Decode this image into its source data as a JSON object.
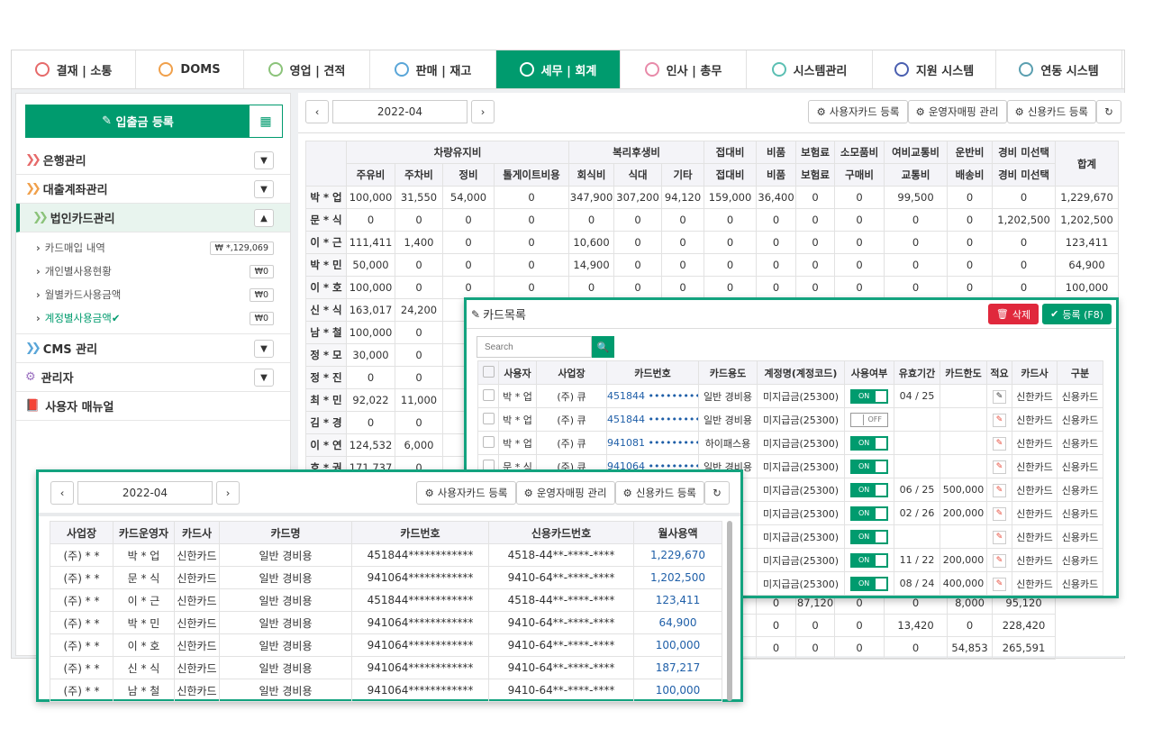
{
  "nav": {
    "tabs": [
      {
        "label": "결재 | 소통",
        "icon": "approval-icon",
        "color": "#e66a6a"
      },
      {
        "label": "DOMS",
        "icon": "doms-icon",
        "color": "#f0a04b"
      },
      {
        "label": "영업 | 견적",
        "icon": "sales-icon",
        "color": "#8bc37a"
      },
      {
        "label": "판매 | 재고",
        "icon": "cart-icon",
        "color": "#5aa6d8"
      },
      {
        "label": "세무 | 회계",
        "icon": "won-icon",
        "color": "#ffffff",
        "active": true
      },
      {
        "label": "인사 | 총무",
        "icon": "person-icon",
        "color": "#e88aa9"
      },
      {
        "label": "시스템관리",
        "icon": "monitor-icon",
        "color": "#5bbfb3"
      },
      {
        "label": "지원 시스템",
        "icon": "support-icon",
        "color": "#4a5fb0"
      },
      {
        "label": "연동 시스템",
        "icon": "link-icon",
        "color": "#5a9fb0"
      }
    ]
  },
  "sidebar": {
    "register_label": "입출금 등록",
    "menus": [
      {
        "label": "은행관리",
        "color": "#e66a6a"
      },
      {
        "label": "대출계좌관리",
        "color": "#f0a04b"
      },
      {
        "label": "법인카드관리",
        "color": "#8bc37a"
      }
    ],
    "subitems": [
      {
        "label": "카드매입 내역",
        "badge": "₩ *,129,069"
      },
      {
        "label": "개인별사용현황",
        "badge": "₩0"
      },
      {
        "label": "월별카드사용금액",
        "badge": "₩0"
      },
      {
        "label": "계정별사용금액",
        "badge": "₩0",
        "active": true
      }
    ],
    "menus2": [
      {
        "label": "CMS 관리",
        "color": "#5aa6d8",
        "icon": "double-chevron-icon"
      },
      {
        "label": "관리자",
        "color": "#9a6fbf",
        "icon": "gear-icon"
      },
      {
        "label": "사용자 매뉴얼",
        "color": "#e66a6a",
        "icon": "book-icon"
      }
    ]
  },
  "toolbar": {
    "month": "2022-04",
    "user_card": "사용자카드 등록",
    "operator_map": "운영자매핑 관리",
    "credit_card": "신용카드 등록"
  },
  "summary": {
    "groups": [
      [
        "차량유지비",
        4
      ],
      [
        "복리후생비",
        3
      ],
      [
        "접대비",
        1
      ],
      [
        "비품",
        1
      ],
      [
        "보험료",
        1
      ],
      [
        "소모품비",
        1
      ],
      [
        "여비교통비",
        1
      ],
      [
        "운반비",
        1
      ],
      [
        "경비 미선택",
        1
      ]
    ],
    "total_label": "합계",
    "subheaders": [
      "주유비",
      "주차비",
      "정비",
      "톨게이트비용",
      "회식비",
      "식대",
      "기타",
      "접대비",
      "비품",
      "보험료",
      "구매비",
      "교통비",
      "배송비",
      "경비 미선택"
    ],
    "rows": [
      [
        "박 * 업",
        "100,000",
        "31,550",
        "54,000",
        "0",
        "347,900",
        "307,200",
        "94,120",
        "159,000",
        "36,400",
        "0",
        "0",
        "99,500",
        "0",
        "0",
        "1,229,670"
      ],
      [
        "문 * 식",
        "0",
        "0",
        "0",
        "0",
        "0",
        "0",
        "0",
        "0",
        "0",
        "0",
        "0",
        "0",
        "0",
        "1,202,500",
        "1,202,500"
      ],
      [
        "이 * 근",
        "111,411",
        "1,400",
        "0",
        "0",
        "10,600",
        "0",
        "0",
        "0",
        "0",
        "0",
        "0",
        "0",
        "0",
        "0",
        "123,411"
      ],
      [
        "박 * 민",
        "50,000",
        "0",
        "0",
        "0",
        "14,900",
        "0",
        "0",
        "0",
        "0",
        "0",
        "0",
        "0",
        "0",
        "0",
        "64,900"
      ],
      [
        "이 * 호",
        "100,000",
        "0",
        "0",
        "0",
        "0",
        "0",
        "0",
        "0",
        "0",
        "0",
        "0",
        "0",
        "0",
        "0",
        "100,000"
      ],
      [
        "신 * 식",
        "163,017",
        "24,200",
        "",
        "",
        "",
        "",
        "",
        "",
        "",
        "",
        "",
        "",
        "",
        "",
        ""
      ],
      [
        "남 * 철",
        "100,000",
        "0",
        "",
        "",
        "",
        "",
        "",
        "",
        "",
        "",
        "",
        "",
        "",
        "",
        ""
      ],
      [
        "정 * 모",
        "30,000",
        "0",
        "",
        "",
        "",
        "",
        "",
        "",
        "",
        "",
        "",
        "",
        "",
        "",
        ""
      ],
      [
        "정 * 진",
        "0",
        "0",
        "",
        "",
        "",
        "",
        "",
        "",
        "",
        "",
        "",
        "",
        "",
        "",
        ""
      ],
      [
        "최 * 민",
        "92,022",
        "11,000",
        "",
        "",
        "",
        "",
        "",
        "",
        "",
        "",
        "",
        "",
        "",
        "",
        ""
      ],
      [
        "김 * 경",
        "0",
        "0",
        "",
        "",
        "",
        "",
        "",
        "",
        "",
        "",
        "",
        "",
        "",
        "",
        ""
      ],
      [
        "이 * 연",
        "124,532",
        "6,000",
        "",
        "",
        "",
        "",
        "",
        "",
        "",
        "",
        "",
        "",
        "",
        "",
        ""
      ],
      [
        "호 * 권",
        "171,737",
        "0",
        "",
        "",
        "",
        "",
        "",
        "",
        "",
        "",
        "",
        "",
        "",
        "",
        ""
      ],
      [
        "",
        "",
        "",
        "",
        "",
        "",
        "",
        "",
        "",
        "",
        "",
        "",
        "",
        "",
        "",
        ""
      ],
      [
        "",
        "",
        "",
        "",
        "",
        "",
        "",
        "",
        "",
        "",
        "",
        "",
        "",
        "",
        "",
        ""
      ],
      [
        "",
        "",
        "",
        "",
        "",
        "",
        "",
        "",
        "",
        "",
        "",
        "",
        "",
        "",
        "",
        ""
      ],
      [
        "",
        "",
        "",
        "",
        "",
        "",
        "",
        "",
        "",
        "",
        "",
        "",
        "",
        "",
        "",
        ""
      ],
      [
        "",
        "",
        "",
        "",
        "",
        "",
        "",
        "",
        "",
        "",
        "",
        "",
        "",
        "",
        "",
        ""
      ],
      [
        "",
        "",
        "",
        "",
        "",
        "",
        "",
        "",
        "0",
        "0",
        "87,120",
        "0",
        "0",
        "8,000",
        "95,120"
      ],
      [
        "",
        "",
        "",
        "",
        "",
        "",
        "",
        "",
        "0",
        "0",
        "0",
        "0",
        "13,420",
        "0",
        "228,420"
      ],
      [
        "",
        "",
        "",
        "",
        "",
        "",
        "",
        "",
        "0",
        "0",
        "0",
        "0",
        "0",
        "54,853",
        "265,591"
      ]
    ]
  },
  "card_list": {
    "title": "카드목록",
    "delete_label": "삭제",
    "register_label": "등록 (F8)",
    "search_placeholder": "Search",
    "headers": [
      "사용자",
      "사업장",
      "카드번호",
      "카드용도",
      "계정명(계정코드)",
      "사용여부",
      "유효기간",
      "카드한도",
      "적요",
      "카드사",
      "구분"
    ],
    "rows": [
      {
        "user": "박 * 업",
        "site": "(주)  큐",
        "num": "451844 ••••••••••",
        "use": "일반 경비용",
        "acct": "미지급금(25300)",
        "on": true,
        "exp": "04 / 25",
        "limit": "",
        "co": "신한카드",
        "type": "신용카드"
      },
      {
        "user": "박 * 업",
        "site": "(주)  큐",
        "num": "451844 ••••••••••",
        "use": "일반 경비용",
        "acct": "미지급금(25300)",
        "on": false,
        "exp": "",
        "limit": "",
        "co": "신한카드",
        "type": "신용카드"
      },
      {
        "user": "박 * 업",
        "site": "(주)  큐",
        "num": "941081 ••••••••••",
        "use": "하이패스용",
        "acct": "미지급금(25300)",
        "on": true,
        "exp": "",
        "limit": "",
        "co": "신한카드",
        "type": "신용카드"
      },
      {
        "user": "문 * 식",
        "site": "(주)  큐",
        "num": "941064 ••••••••••",
        "use": "일반 경비용",
        "acct": "미지급금(25300)",
        "on": true,
        "exp": "",
        "limit": "",
        "co": "신한카드",
        "type": "신용카드"
      },
      {
        "user": "",
        "site": "",
        "num": "",
        "use": "",
        "acct": "미지급금(25300)",
        "on": true,
        "exp": "06 / 25",
        "limit": "500,000",
        "co": "신한카드",
        "type": "신용카드"
      },
      {
        "user": "",
        "site": "",
        "num": "",
        "use": "",
        "acct": "미지급금(25300)",
        "on": true,
        "exp": "02 / 26",
        "limit": "200,000",
        "co": "신한카드",
        "type": "신용카드"
      },
      {
        "user": "",
        "site": "",
        "num": "",
        "use": "",
        "acct": "미지급금(25300)",
        "on": true,
        "exp": "",
        "limit": "",
        "co": "신한카드",
        "type": "신용카드"
      },
      {
        "user": "",
        "site": "",
        "num": "",
        "use": "",
        "acct": "미지급금(25300)",
        "on": true,
        "exp": "11 / 22",
        "limit": "200,000",
        "co": "신한카드",
        "type": "신용카드"
      },
      {
        "user": "",
        "site": "",
        "num": "",
        "use": "",
        "acct": "미지급금(25300)",
        "on": true,
        "exp": "08 / 24",
        "limit": "400,000",
        "co": "신한카드",
        "type": "신용카드"
      }
    ],
    "on_label": "ON",
    "off_label": "OFF"
  },
  "monthly": {
    "headers": [
      "사업장",
      "카드운영자",
      "카드사",
      "카드명",
      "카드번호",
      "신용카드번호",
      "월사용액"
    ],
    "rows": [
      [
        "(주) * *",
        "박 * 업",
        "신한카드",
        "일반 경비용",
        "451844************",
        "4518-44**-****-****",
        "1,229,670"
      ],
      [
        "(주) * *",
        "문 * 식",
        "신한카드",
        "일반 경비용",
        "941064************",
        "9410-64**-****-****",
        "1,202,500"
      ],
      [
        "(주) * *",
        "이 * 근",
        "신한카드",
        "일반 경비용",
        "451844************",
        "4518-44**-****-****",
        "123,411"
      ],
      [
        "(주) * *",
        "박 * 민",
        "신한카드",
        "일반 경비용",
        "941064************",
        "9410-64**-****-****",
        "64,900"
      ],
      [
        "(주) * *",
        "이 * 호",
        "신한카드",
        "일반 경비용",
        "941064************",
        "9410-64**-****-****",
        "100,000"
      ],
      [
        "(주) * *",
        "신 * 식",
        "신한카드",
        "일반 경비용",
        "941064************",
        "9410-64**-****-****",
        "187,217"
      ],
      [
        "(주) * *",
        "남 * 철",
        "신한카드",
        "일반 경비용",
        "941064************",
        "9410-64**-****-****",
        "100,000"
      ]
    ]
  },
  "colors": {
    "accent": "#009b6e",
    "overlay_border": "#13a37f",
    "delete": "#e0283c",
    "amount": "#1f5fa8"
  }
}
